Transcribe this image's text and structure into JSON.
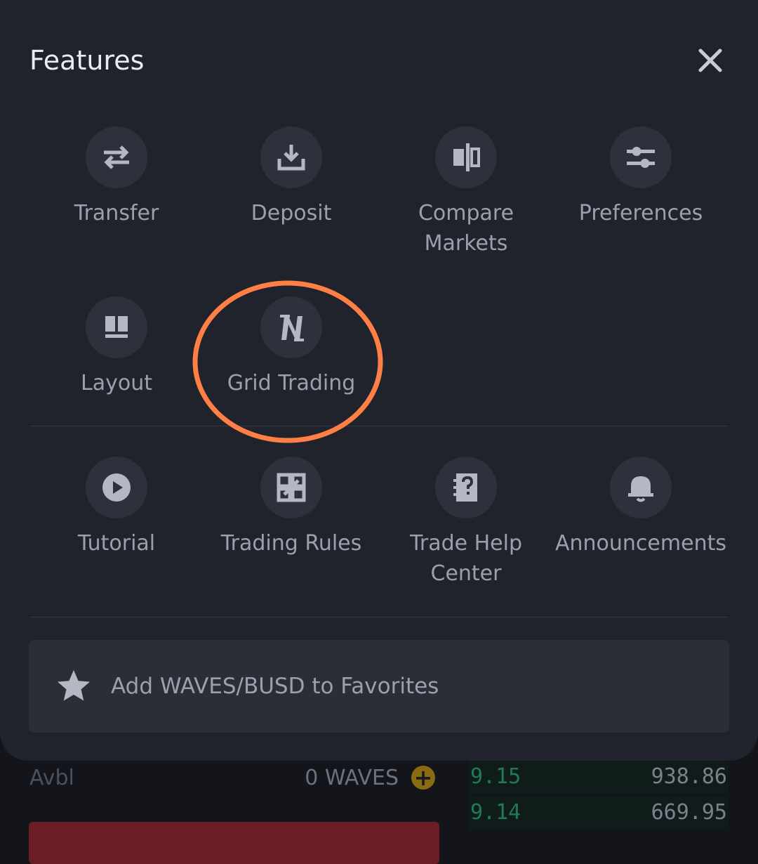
{
  "sheet": {
    "title": "Features",
    "row1": [
      {
        "label": "Transfer",
        "icon": "transfer-arrows-icon"
      },
      {
        "label": "Deposit",
        "icon": "download-icon"
      },
      {
        "label": "Compare Markets",
        "icon": "compare-icon"
      },
      {
        "label": "Preferences",
        "icon": "sliders-icon"
      }
    ],
    "row2": [
      {
        "label": "Layout",
        "icon": "layout-icon"
      },
      {
        "label": "Grid Trading",
        "icon": "grid-trading-icon"
      }
    ],
    "row3": [
      {
        "label": "Tutorial",
        "icon": "play-icon"
      },
      {
        "label": "Trading Rules",
        "icon": "rules-icon"
      },
      {
        "label": "Trade Help Center",
        "icon": "help-book-icon"
      },
      {
        "label": "Announcements",
        "icon": "bell-icon"
      }
    ],
    "favorite": {
      "label": "Add WAVES/BUSD to Favorites",
      "icon": "star-icon"
    }
  },
  "background": {
    "avbl_label": "Avbl",
    "avbl_value": "0 WAVES",
    "orderbook": [
      {
        "price": "9.15",
        "qty": "938.86"
      },
      {
        "price": "9.14",
        "qty": "669.95"
      }
    ]
  },
  "colors": {
    "sheet_bg": "#20232c",
    "icon_circle": "#2d313b",
    "label": "#9aa0ad",
    "highlight": "#ff7f45",
    "buy_green": "#1f7a55",
    "sell_red": "#6a1d25"
  }
}
